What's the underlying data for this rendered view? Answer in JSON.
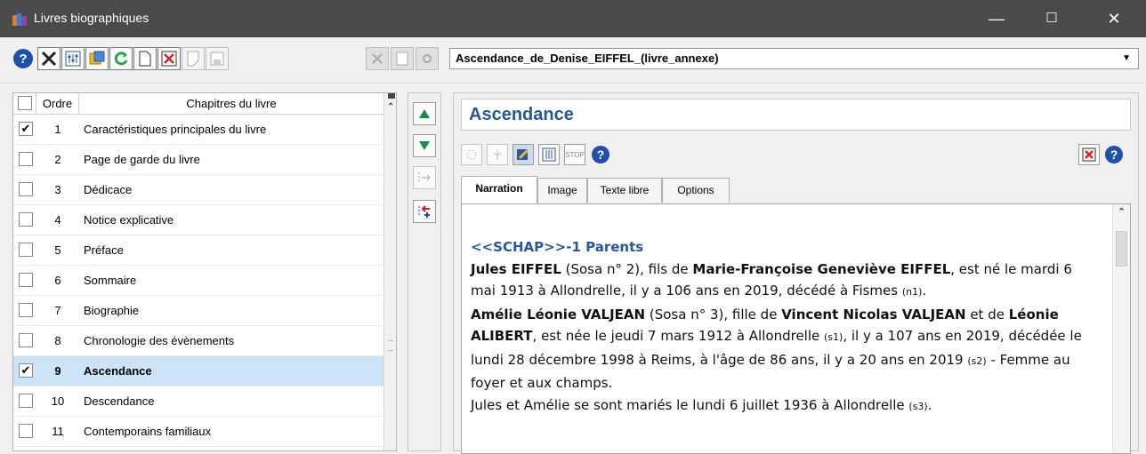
{
  "window": {
    "title": "Livres biographiques",
    "minimize": "—",
    "maximize": "☐",
    "close": "✕"
  },
  "toolbar": {
    "book_select": "Ascendance_de_Denise_EIFFEL_(livre_annexe)"
  },
  "chapters": {
    "header": {
      "order": "Ordre",
      "name": "Chapitres du livre"
    },
    "rows": [
      {
        "num": "1",
        "label": "Caractéristiques principales du livre",
        "checked": true,
        "selected": false
      },
      {
        "num": "2",
        "label": "Page de garde du livre",
        "checked": false,
        "selected": false
      },
      {
        "num": "3",
        "label": "Dédicace",
        "checked": false,
        "selected": false
      },
      {
        "num": "4",
        "label": "Notice explicative",
        "checked": false,
        "selected": false
      },
      {
        "num": "5",
        "label": "Préface",
        "checked": false,
        "selected": false
      },
      {
        "num": "6",
        "label": "Sommaire",
        "checked": false,
        "selected": false
      },
      {
        "num": "7",
        "label": "Biographie",
        "checked": false,
        "selected": false
      },
      {
        "num": "8",
        "label": "Chronologie des évènements",
        "checked": false,
        "selected": false
      },
      {
        "num": "9",
        "label": "Ascendance",
        "checked": true,
        "selected": true
      },
      {
        "num": "10",
        "label": "Descendance",
        "checked": false,
        "selected": false
      },
      {
        "num": "11",
        "label": "Contemporains familiaux",
        "checked": false,
        "selected": false
      }
    ]
  },
  "chapter_panel": {
    "title": "Ascendance",
    "stop_label": "STOP",
    "tabs": [
      "Narration",
      "Image",
      "Texte libre",
      "Options"
    ]
  },
  "narration": {
    "chapter_heading": "<<SCHAP>>-1 Parents",
    "p1_name": "Jules EIFFEL",
    "p1_a": " (Sosa n° 2), fils de ",
    "p1_parent": "Marie-Françoise Geneviève EIFFEL",
    "p1_b": ", est né le mardi 6 mai 1913 à Allondrelle, il y a 106 ans en 2019, décédé à Fismes ",
    "p1_note": "(n1)",
    "p1_end": ".",
    "p2_name": "Amélie Léonie VALJEAN",
    "p2_a": " (Sosa n° 3), fille de ",
    "p2_father": "Vincent Nicolas VALJEAN",
    "p2_b": " et de ",
    "p2_mother": "Léonie ALIBERT",
    "p2_c": ", est née le jeudi 7 mars 1912 à Allondrelle ",
    "p2_note1": "(s1)",
    "p2_d": ", il y a 107 ans en 2019, décédée le lundi 28 décembre 1998 à Reims, à l'âge de 86 ans, il y a 20 ans en 2019 ",
    "p2_note2": "(s2)",
    "p2_e": " - Femme au foyer et aux champs.",
    "p3": "Jules et Amélie se sont mariés le lundi 6 juillet 1936 à Allondrelle ",
    "p3_note": "(s3)",
    "p3_end": "."
  },
  "colors": {
    "titlebar": "#4a4a4a",
    "accent_blue": "#2b5797",
    "selection": "#cde3f7"
  }
}
